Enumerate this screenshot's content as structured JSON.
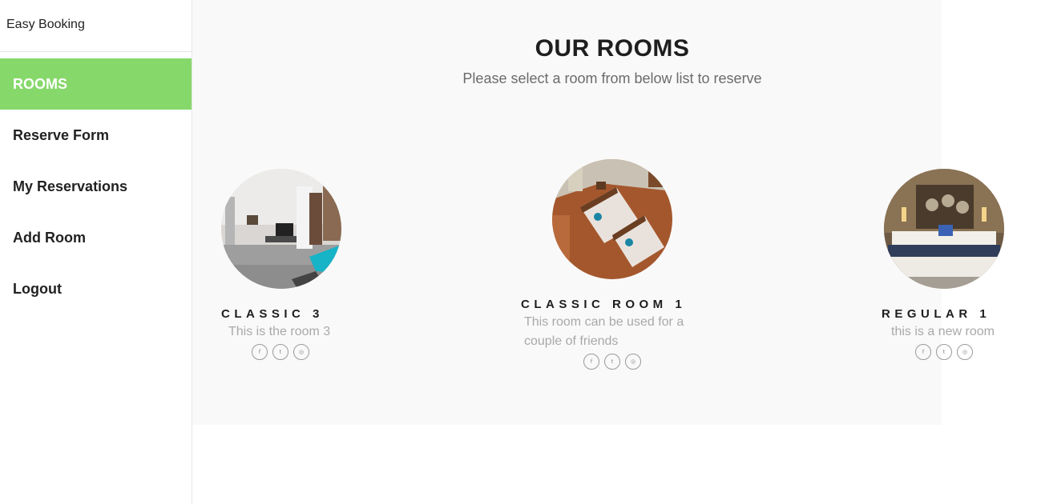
{
  "app": {
    "brand": "Easy Booking"
  },
  "sidebar": {
    "items": [
      {
        "label": "ROOMS",
        "active": true
      },
      {
        "label": "Reserve Form"
      },
      {
        "label": "My Reservations"
      },
      {
        "label": "Add Room"
      },
      {
        "label": "Logout"
      }
    ]
  },
  "header": {
    "title": "OUR ROOMS",
    "subtitle": "Please select a room from below list to reserve"
  },
  "rooms": [
    {
      "name": "CLASSIC 3",
      "description": "This is the room 3",
      "image": "modern-room-photo"
    },
    {
      "name": "CLASSIC ROOM 1",
      "description": "This room can be used for a couple of friends",
      "image": "twin-bed-room-photo"
    },
    {
      "name": "REGULAR 1",
      "description": "this is a new room",
      "image": "double-bed-room-photo"
    }
  ],
  "social_icons": {
    "facebook": "f",
    "twitter": "t",
    "instagram": "◎"
  },
  "colors": {
    "accent": "#86d86a",
    "panel_bg": "#f9f9f9",
    "muted_text": "#a9a9a9"
  }
}
